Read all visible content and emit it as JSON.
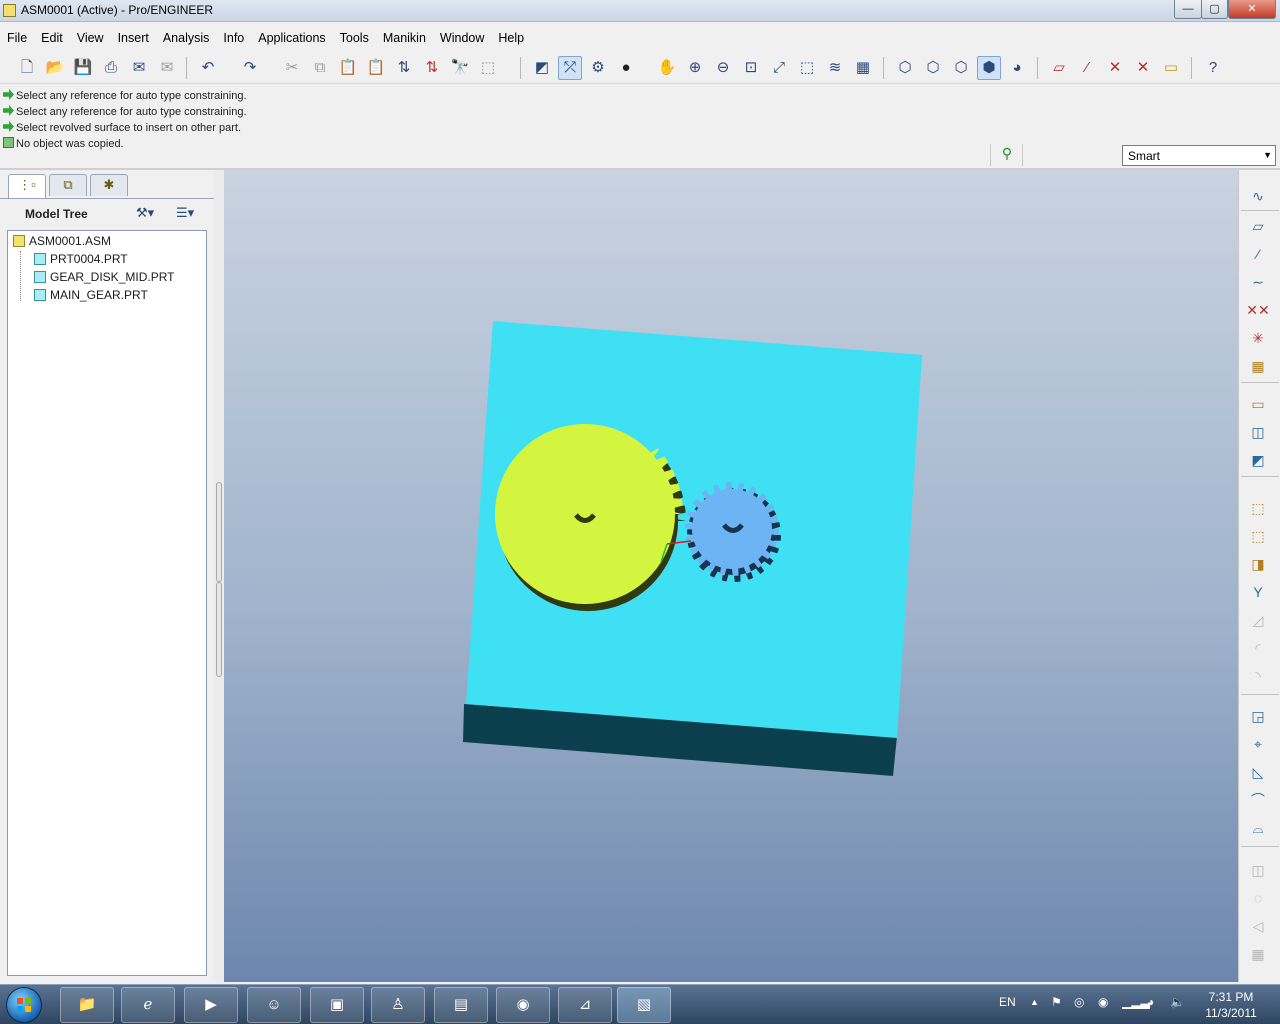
{
  "window": {
    "title": "ASM0001 (Active) - Pro/ENGINEER",
    "minimize": "—",
    "maximize": "▢",
    "close": "✕"
  },
  "menu": [
    "File",
    "Edit",
    "View",
    "Insert",
    "Analysis",
    "Info",
    "Applications",
    "Tools",
    "Manikin",
    "Window",
    "Help"
  ],
  "messages": [
    {
      "text": "Select any reference for auto type constraining.",
      "icon": "arrow"
    },
    {
      "text": "Select any reference for auto type constraining.",
      "icon": "arrow"
    },
    {
      "text": "Select revolved surface to insert on other part.",
      "icon": "arrow"
    },
    {
      "text": "No object was copied.",
      "icon": "copy"
    }
  ],
  "filter": {
    "value": "Smart"
  },
  "model_tree": {
    "title": "Model Tree",
    "items": [
      {
        "name": "ASM0001.ASM",
        "type": "assembly"
      },
      {
        "name": "PRT0004.PRT",
        "type": "part"
      },
      {
        "name": "GEAR_DISK_MID.PRT",
        "type": "part"
      },
      {
        "name": "MAIN_GEAR.PRT",
        "type": "part"
      }
    ]
  },
  "colors": {
    "plate": "#40e0f4",
    "plate_side": "#0b3f4d",
    "main_gear": "#d4f540",
    "main_gear_side": "#2f3a10",
    "small_gear": "#6cb4f4",
    "small_gear_side": "#1a3350"
  },
  "taskbar": {
    "language": "EN",
    "time": "7:31 PM",
    "date": "11/3/2011"
  }
}
